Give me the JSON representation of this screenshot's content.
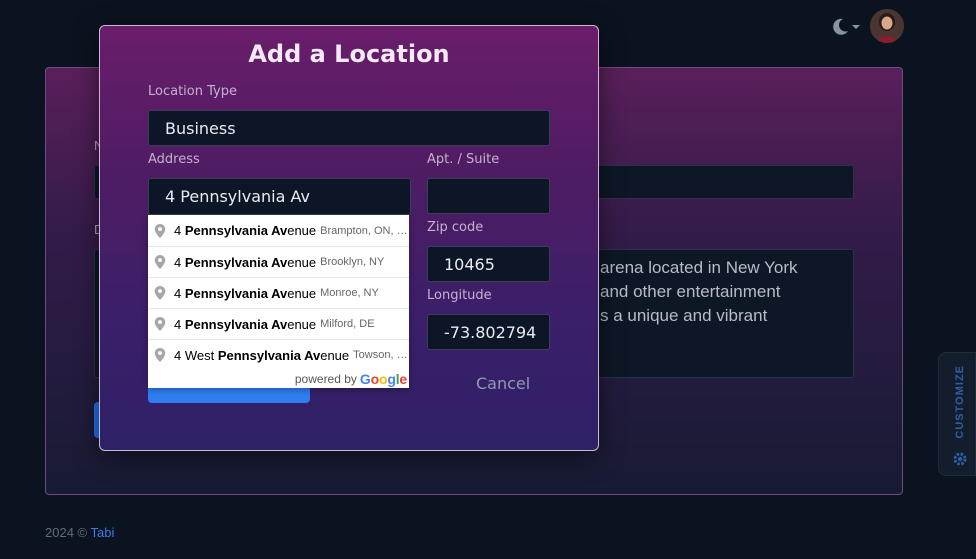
{
  "topbar": {
    "theme_icon": "moon-icon",
    "avatar_icon": "user-avatar"
  },
  "background_form": {
    "label_name_initial": "N",
    "label_desc_initial": "D",
    "description_lines": [
      "arena located in New York",
      "and other entertainment",
      "s a unique and vibrant"
    ]
  },
  "modal": {
    "title": "Add a Location",
    "location_type_label": "Location Type",
    "location_type_value": "Business",
    "address_label": "Address",
    "address_value": "4 Pennsylvania Av",
    "apt_label": "Apt. / Suite",
    "apt_value": "",
    "zip_label": "Zip code",
    "zip_value": "10465",
    "longitude_label": "Longitude",
    "longitude_value": "-73.802794",
    "cancel_label": "Cancel"
  },
  "autocomplete": {
    "items": [
      {
        "prefix": "4 ",
        "bold": "Pennsylvania Av",
        "rest": "enue",
        "secondary": "Brampton, ON, Canada"
      },
      {
        "prefix": "4 ",
        "bold": "Pennsylvania Av",
        "rest": "enue",
        "secondary": "Brooklyn, NY"
      },
      {
        "prefix": "4 ",
        "bold": "Pennsylvania Av",
        "rest": "enue",
        "secondary": "Monroe, NY"
      },
      {
        "prefix": "4 ",
        "bold": "Pennsylvania Av",
        "rest": "enue",
        "secondary": "Milford, DE"
      },
      {
        "prefix": "4 West ",
        "bold": "Pennsylvania Av",
        "rest": "enue",
        "secondary": "Towson, MD"
      }
    ],
    "powered_by": "powered by",
    "google": "Google"
  },
  "customize": {
    "label": "CUSTOMIZE",
    "icon": "gear-icon"
  },
  "footer": {
    "copyright": "2024 © ",
    "brand": "Tabi"
  },
  "colors": {
    "accent": "#2f7df0",
    "modal_top": "#6a1d6a",
    "modal_bottom": "#2f2166",
    "page_bg": "#0b1320"
  }
}
